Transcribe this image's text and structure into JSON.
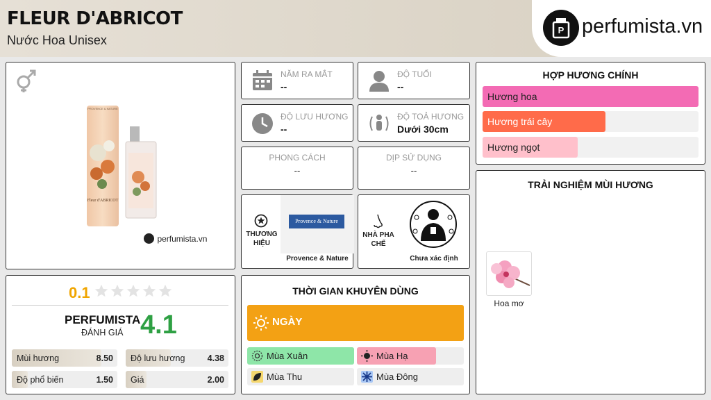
{
  "header": {
    "title": "FLEUR D'ABRICOT",
    "subtitle": "Nước Hoa Unisex",
    "logo_text": "perfumista.vn"
  },
  "product": {
    "gender_icon": "unisex-icon",
    "watermark": "perfumista.vn",
    "box_brand": "PROVENCE & NATURE",
    "box_name": "Fleur d'ABRICOT"
  },
  "info": {
    "year_label": "NĂM RA MẮT",
    "year_value": "--",
    "age_label": "ĐỘ TUỔI",
    "age_value": "--",
    "longevity_label": "ĐỘ LƯU HƯƠNG",
    "longevity_value": "--",
    "sillage_label": "ĐỘ TOẢ HƯƠNG",
    "sillage_value": "Dưới 30cm",
    "style_label": "PHONG CÁCH",
    "style_value": "--",
    "occasion_label": "DỊP SỬ DỤNG",
    "occasion_value": "--",
    "brand_label_1": "THƯƠNG",
    "brand_label_2": "HIỆU",
    "brand_value": "Provence & Nature",
    "brand_logo_text": "Provence & Nature",
    "perfumer_label_1": "NHÀ PHA",
    "perfumer_label_2": "CHẾ",
    "perfumer_value": "Chưa xác định"
  },
  "accords": {
    "title": "HỢP HƯƠNG CHÍNH",
    "items": [
      {
        "label": "Hương hoa",
        "value": 1.0,
        "color": "#f36bb4"
      },
      {
        "label": "Hương trái cây",
        "value": 0.57,
        "color": "#ff6b4a"
      },
      {
        "label": "Hương ngọt",
        "value": 0.44,
        "color": "#ffc0cb"
      }
    ]
  },
  "experience": {
    "title": "TRẢI NGHIỆM MÙI HƯƠNG",
    "notes": [
      {
        "label": "Hoa mơ"
      }
    ]
  },
  "rating": {
    "user_score": "0.1",
    "user_stars": 0.02,
    "brand": "PERFUMISTA",
    "brand_sub": "ĐÁNH GIÁ",
    "brand_score": "4.1",
    "scores": [
      {
        "label": "Mùi hương",
        "value": "8.50",
        "fill": 0.85
      },
      {
        "label": "Độ lưu hương",
        "value": "4.38",
        "fill": 0.44
      },
      {
        "label": "Độ phổ biến",
        "value": "1.50",
        "fill": 0.15
      },
      {
        "label": "Giá",
        "value": "2.00",
        "fill": 0.2
      }
    ]
  },
  "time": {
    "title": "THỜI GIAN KHUYÊN DÙNG",
    "day_label": "NGÀY",
    "day_color": "#f3a114",
    "seasons": [
      {
        "label": "Mùa Xuân",
        "fill": 1.0,
        "color": "#8ee6a8"
      },
      {
        "label": "Mùa Hạ",
        "fill": 0.74,
        "color": "#f7a1b3"
      },
      {
        "label": "Mùa Thu",
        "fill": 0.0,
        "color": "#f5d76e"
      },
      {
        "label": "Mùa Đông",
        "fill": 0.0,
        "color": "#a9c8f5"
      }
    ]
  }
}
